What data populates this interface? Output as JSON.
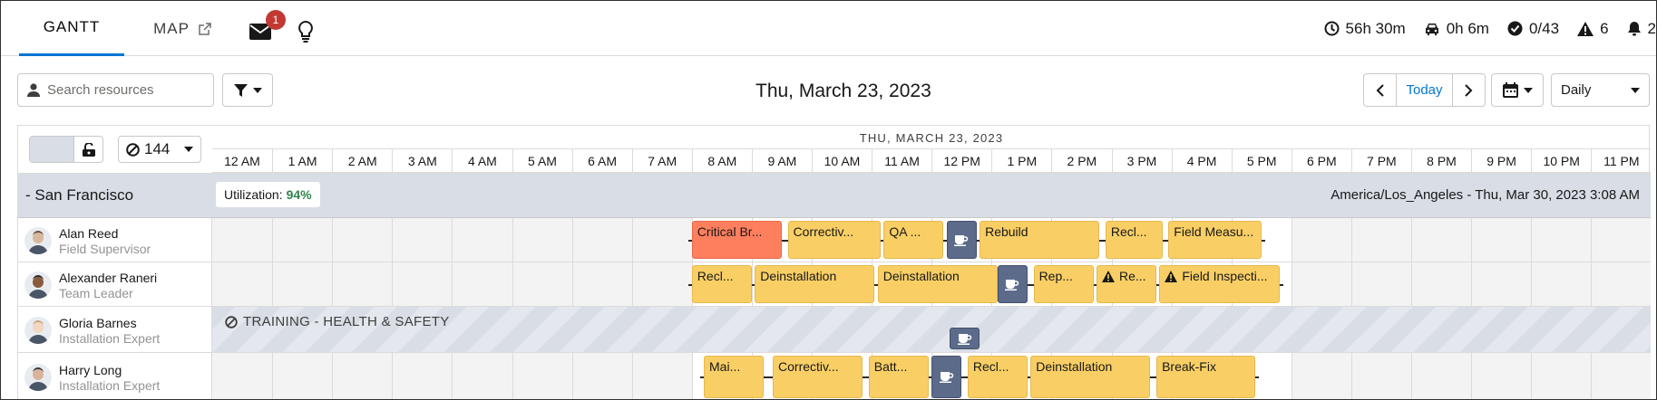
{
  "nav": {
    "tabs": [
      {
        "label": "GANTT"
      },
      {
        "label": "MAP"
      }
    ],
    "mail_badge": "1",
    "kpis": [
      {
        "icon": "clock-icon",
        "value": "56h 30m"
      },
      {
        "icon": "car-icon",
        "value": "0h 6m"
      },
      {
        "icon": "check-circle-icon",
        "value": "0/43"
      },
      {
        "icon": "warning-icon",
        "value": "6"
      },
      {
        "icon": "bell-icon",
        "value": "2"
      }
    ]
  },
  "toolbar": {
    "search_placeholder": "Search resources",
    "date": "Thu, March 23, 2023",
    "today": "Today",
    "view": "Daily"
  },
  "gantt": {
    "resource_count": "144",
    "day_header": "THU, MARCH 23, 2023",
    "hours": [
      "12 AM",
      "1 AM",
      "2 AM",
      "3 AM",
      "4 AM",
      "5 AM",
      "6 AM",
      "7 AM",
      "8 AM",
      "9 AM",
      "10 AM",
      "11 AM",
      "12 PM",
      "1 PM",
      "2 PM",
      "3 PM",
      "4 PM",
      "5 PM",
      "6 PM",
      "7 PM",
      "8 PM",
      "9 PM",
      "10 PM",
      "11 PM"
    ],
    "group": {
      "label": "- San Francisco",
      "utilization_label": "Utilization:",
      "utilization_value": "94%",
      "timezone": "America/Los_Angeles - Thu, Mar 30, 2023 3:08 AM"
    },
    "resources": [
      {
        "name": "Alan Reed",
        "role": "Field Supervisor",
        "appointments": [
          {
            "label": "Critical Br...",
            "start": 8.0,
            "end": 9.5,
            "color": "red"
          },
          {
            "label": "Correctiv...",
            "start": 9.6,
            "end": 11.15
          },
          {
            "label": "QA ...",
            "start": 11.2,
            "end": 12.2
          },
          {
            "break": true,
            "start": 12.25,
            "end": 12.75
          },
          {
            "label": "Rebuild",
            "start": 12.8,
            "end": 14.8
          },
          {
            "label": "Recl...",
            "start": 14.9,
            "end": 15.85
          },
          {
            "label": "Field Measu...",
            "start": 15.95,
            "end": 17.5
          }
        ]
      },
      {
        "name": "Alexander Raneri",
        "role": "Team Leader",
        "appointments": [
          {
            "label": "Recl...",
            "start": 8.0,
            "end": 9.0
          },
          {
            "label": "Deinstallation",
            "start": 9.05,
            "end": 11.05
          },
          {
            "label": "Deinstallation",
            "start": 11.1,
            "end": 13.1
          },
          {
            "break": true,
            "start": 13.1,
            "end": 13.6
          },
          {
            "label": "Rep...",
            "start": 13.7,
            "end": 14.7
          },
          {
            "label": "Re...",
            "start": 14.75,
            "end": 15.75,
            "warning": true
          },
          {
            "label": "Field Inspecti...",
            "start": 15.8,
            "end": 17.8,
            "warning": true
          }
        ]
      },
      {
        "name": "Gloria Barnes",
        "role": "Installation Expert",
        "training": "TRAINING - HEALTH & SAFETY",
        "appointments": [
          {
            "break": true,
            "start": 12.3,
            "end": 12.8
          }
        ]
      },
      {
        "name": "Harry Long",
        "role": "Installation Expert",
        "appointments": [
          {
            "label": "Mai...",
            "start": 8.2,
            "end": 9.2
          },
          {
            "label": "Correctiv...",
            "start": 9.35,
            "end": 10.85
          },
          {
            "label": "Batt...",
            "start": 10.95,
            "end": 11.95
          },
          {
            "break": true,
            "start": 12.0,
            "end": 12.5
          },
          {
            "label": "Recl...",
            "start": 12.6,
            "end": 13.6
          },
          {
            "label": "Deinstallation",
            "start": 13.65,
            "end": 15.65
          },
          {
            "label": "Break-Fix",
            "start": 15.75,
            "end": 17.4
          }
        ]
      }
    ]
  }
}
